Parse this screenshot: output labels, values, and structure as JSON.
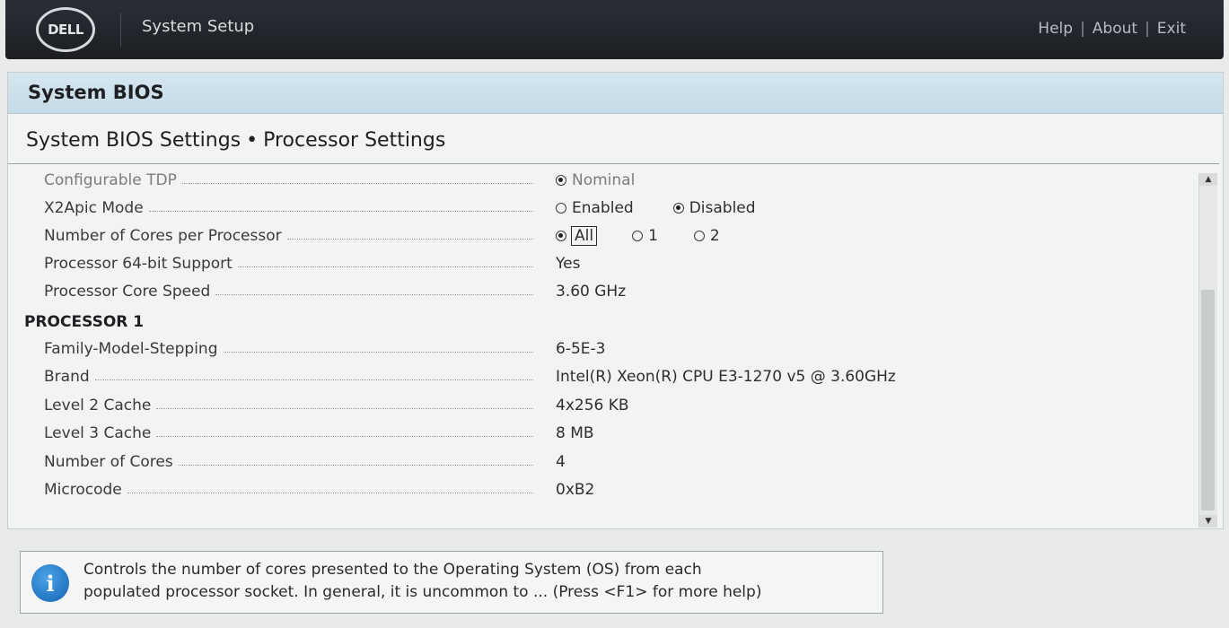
{
  "header": {
    "logo_text": "DELL",
    "app_title": "System Setup",
    "links": [
      "Help",
      "About",
      "Exit"
    ],
    "separator": "|"
  },
  "panel": {
    "title": "System BIOS",
    "breadcrumb": [
      "System BIOS Settings",
      "Processor Settings"
    ],
    "breadcrumb_separator": "•"
  },
  "settings": [
    {
      "label": "Configurable TDP",
      "type": "radio",
      "disabled": true,
      "options": [
        {
          "label": "Nominal",
          "selected": true
        }
      ]
    },
    {
      "label": "X2Apic Mode",
      "type": "radio",
      "options": [
        {
          "label": "Enabled",
          "selected": false
        },
        {
          "label": "Disabled",
          "selected": true
        }
      ]
    },
    {
      "label": "Number of Cores per Processor",
      "type": "radio",
      "options": [
        {
          "label": "All",
          "selected": true
        },
        {
          "label": "1",
          "selected": false
        },
        {
          "label": "2",
          "selected": false
        }
      ]
    },
    {
      "label": "Processor 64-bit Support",
      "type": "text",
      "value": "Yes"
    },
    {
      "label": "Processor Core Speed",
      "type": "text",
      "value": "3.60 GHz"
    }
  ],
  "processor_section": {
    "title": "PROCESSOR 1",
    "items": [
      {
        "label": "Family-Model-Stepping",
        "value": "6-5E-3"
      },
      {
        "label": "Brand",
        "value": "Intel(R) Xeon(R) CPU E3-1270 v5 @ 3.60GHz"
      },
      {
        "label": "Level 2 Cache",
        "value": "4x256 KB"
      },
      {
        "label": "Level 3 Cache",
        "value": "8 MB"
      },
      {
        "label": "Number of Cores",
        "value": "4"
      },
      {
        "label": "Microcode",
        "value": "0xB2"
      }
    ]
  },
  "help": {
    "icon": "info-icon",
    "line1": "Controls the number of cores presented to the Operating System (OS) from each",
    "line2": "populated processor socket. In general, it is uncommon to ... (Press <F1> for more help)"
  },
  "colors": {
    "topbar": "#1f2227",
    "panel_header": "#c9dde8",
    "info_icon": "#1a6fc0"
  }
}
